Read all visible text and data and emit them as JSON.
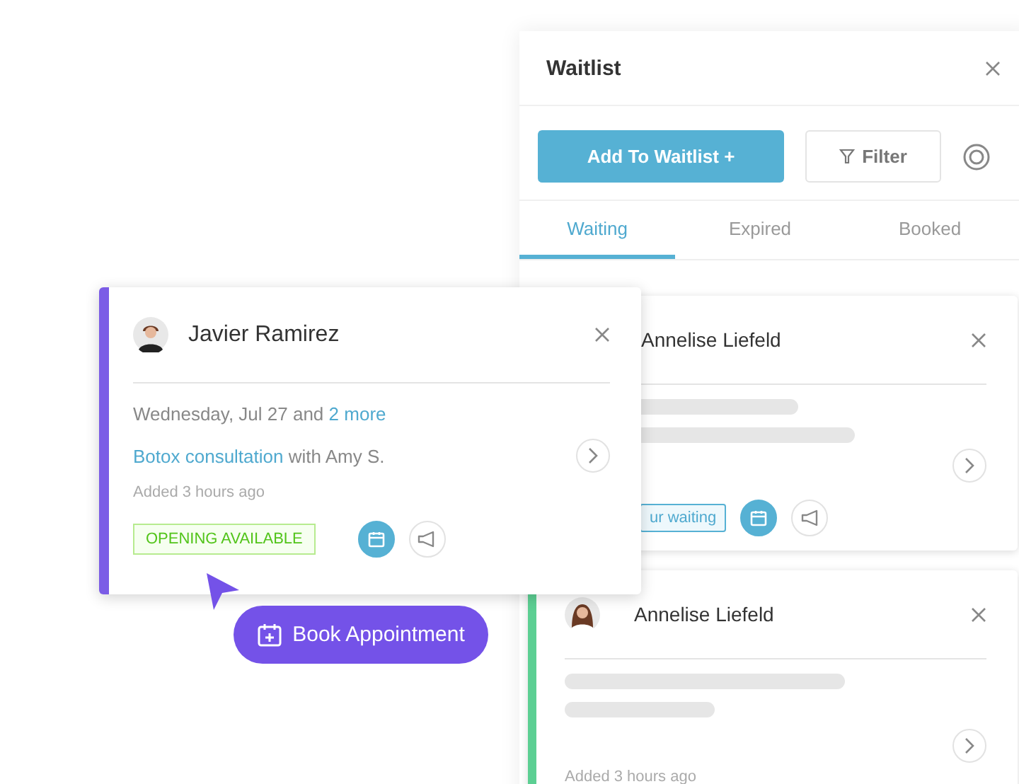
{
  "panel": {
    "title": "Waitlist",
    "add_button": "Add To Waitlist +",
    "filter_button": "Filter",
    "tabs": [
      {
        "label": "Waiting",
        "selected": true
      },
      {
        "label": "Expired",
        "selected": false
      },
      {
        "label": "Booked",
        "selected": false
      }
    ],
    "entries": [
      {
        "name": "Annelise Liefeld",
        "chip": "ur waiting"
      },
      {
        "name": "Annelise Liefeld",
        "color": "#5ccf93",
        "added": "Added 3 hours ago"
      }
    ]
  },
  "popup": {
    "name": "Javier Ramirez",
    "color": "#7b5ce6",
    "date": "Wednesday, Jul 27 and",
    "more_link": "2 more",
    "service": "Botox consultation",
    "with": "with Amy S.",
    "added": "Added 3 hours ago",
    "badge": "OPENING AVAILABLE"
  },
  "book_button": "Book Appointment"
}
